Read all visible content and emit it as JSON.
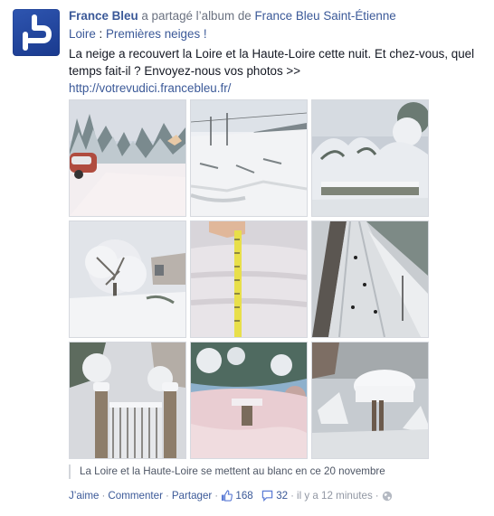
{
  "post": {
    "page_name": "France Bleu",
    "shared_text": " a partagé l’album de ",
    "album_owner": "France Bleu Saint-Étienne",
    "album_owner_line2": "Loire",
    "album_sep": " : ",
    "album_title": "Premières neiges !",
    "message": "La neige a recouvert la Loire et la Haute-Loire cette nuit. Et chez-vous, quel temps fait-il ? Envoyez-nous vos photos >>",
    "url": "http://votrevudici.francebleu.fr/",
    "caption": "La Loire et la Haute-Loire se mettent au blanc en ce 20 novembre",
    "avatar_icon": "france-bleu-logo-icon",
    "brand_color": "#1e3f95"
  },
  "photos": [
    {
      "name": "photo-snowy-street-car",
      "icon": "snow-scene"
    },
    {
      "name": "photo-snowy-field-fence",
      "icon": "snow-scene"
    },
    {
      "name": "photo-snow-covered-bushes",
      "icon": "snow-scene"
    },
    {
      "name": "photo-snowy-tree-garden",
      "icon": "snow-scene"
    },
    {
      "name": "photo-snow-depth-measuring-tape",
      "icon": "snow-scene"
    },
    {
      "name": "photo-snowy-street-from-above",
      "icon": "snow-scene"
    },
    {
      "name": "photo-snowy-gate",
      "icon": "snow-scene"
    },
    {
      "name": "photo-snowy-garden-table",
      "icon": "snow-scene"
    },
    {
      "name": "photo-snow-on-garden-table",
      "icon": "snow-scene"
    }
  ],
  "actions": {
    "like": "J’aime",
    "comment": "Commenter",
    "share": "Partager",
    "sep": "·",
    "likes_count": "168",
    "comments_count": "32",
    "time": "il y a 12 minutes",
    "like_icon": "thumbs-up-icon",
    "comment_icon": "comment-bubble-icon",
    "privacy_icon": "globe-icon"
  },
  "colors": {
    "link": "#3b5998",
    "muted": "#9197a3",
    "text": "#141823"
  }
}
